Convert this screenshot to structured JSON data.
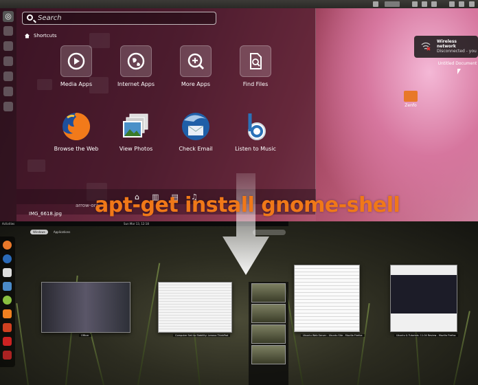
{
  "unity": {
    "search": {
      "placeholder": "Search"
    },
    "shortcuts_label": "Shortcuts",
    "lenses": [
      {
        "label": "Media Apps",
        "icon": "media-apps-icon"
      },
      {
        "label": "Internet Apps",
        "icon": "internet-apps-icon"
      },
      {
        "label": "More Apps",
        "icon": "more-apps-icon"
      },
      {
        "label": "Find Files",
        "icon": "find-files-icon"
      }
    ],
    "apps": [
      {
        "label": "Browse the Web",
        "icon": "firefox-icon"
      },
      {
        "label": "View Photos",
        "icon": "photos-icon"
      },
      {
        "label": "Check Email",
        "icon": "thunderbird-icon"
      },
      {
        "label": "Listen to Music",
        "icon": "banshee-icon"
      }
    ],
    "file_label": "IMG_6618.jpg",
    "bg_label": "arrow-ora",
    "notification": {
      "title": "Wireless network",
      "body": "Disconnected - you are"
    },
    "desktop_icons": [
      "Untitled Document",
      "Zenfo"
    ]
  },
  "gnome": {
    "panel_left": "Activities",
    "panel_center": "Sun Mar 13, 12:18",
    "tabs": [
      "Windows",
      "Applications"
    ],
    "window_captions": [
      "Officer",
      "Computer Set-Up Stability: Lenovo ThinkPad",
      "Ubuntu Web Server - Ubuntu Site - Mozilla Firefox",
      "Ubuntu & Tutorials: 11.04 Review - Mozilla Firefox"
    ]
  },
  "caption": "apt-get install gnome-shell",
  "colors": {
    "caption": "#f07818",
    "unity_accent": "#d6769e"
  }
}
